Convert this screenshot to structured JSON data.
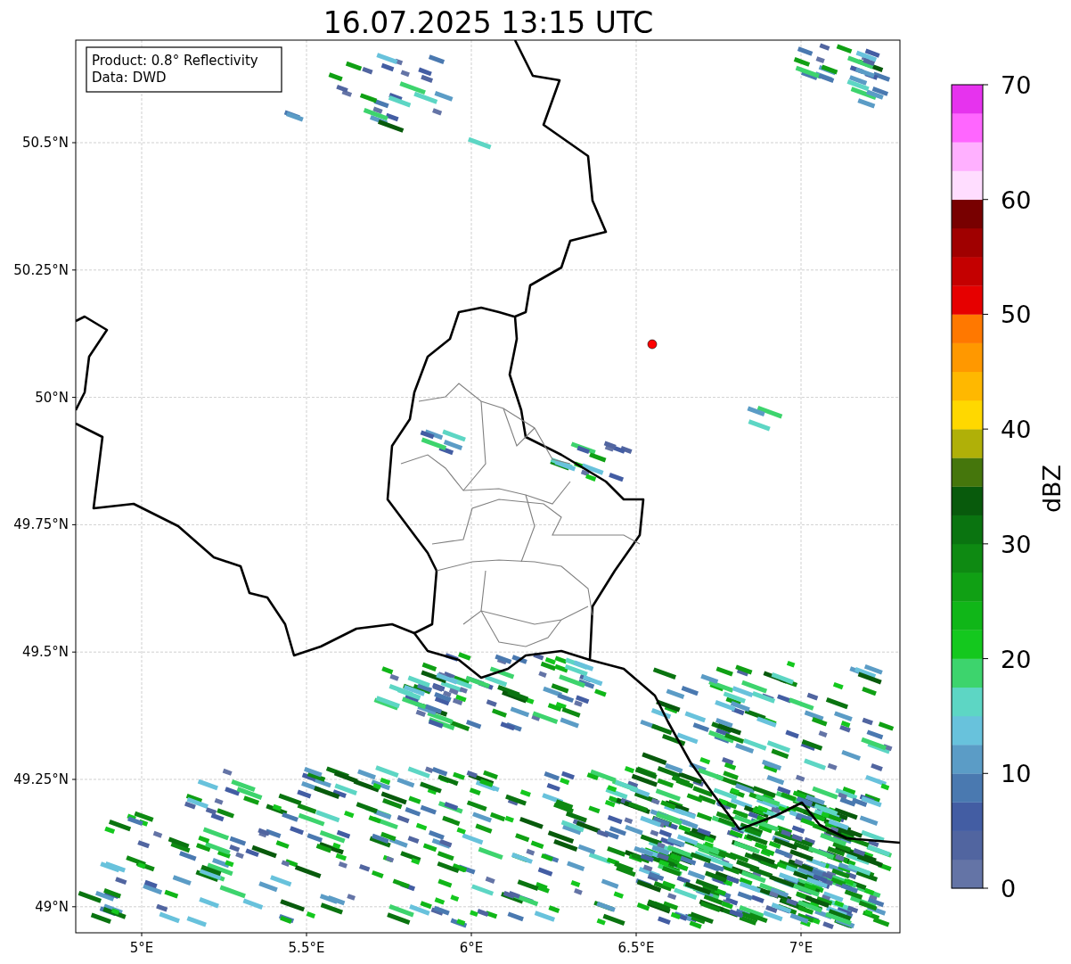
{
  "title": "16.07.2025 13:15 UTC",
  "legend": [
    "Product: 0.8° Reflectivity",
    "Data: DWD"
  ],
  "lat_ticks": [
    "50.5°N",
    "50.25°N",
    "50°N",
    "49.75°N",
    "49.5°N",
    "49.25°N",
    "49°N"
  ],
  "lon_ticks": [
    "5°E",
    "5.5°E",
    "6°E",
    "6.5°E",
    "7°E"
  ],
  "colorbar": {
    "label": "dBZ",
    "ticks": [
      "70",
      "60",
      "50",
      "40",
      "30",
      "20",
      "10",
      "0"
    ],
    "bands": [
      {
        "color": "#e633ee"
      },
      {
        "color": "#ff66ff"
      },
      {
        "color": "#ffb0ff"
      },
      {
        "color": "#ffddff"
      },
      {
        "color": "#780000"
      },
      {
        "color": "#a00000"
      },
      {
        "color": "#c40000"
      },
      {
        "color": "#e60000"
      },
      {
        "color": "#ff7800"
      },
      {
        "color": "#ff9800"
      },
      {
        "color": "#ffb800"
      },
      {
        "color": "#ffd800"
      },
      {
        "color": "#b0b008"
      },
      {
        "color": "#45760c"
      },
      {
        "color": "#085a0c"
      },
      {
        "color": "#0a7410"
      },
      {
        "color": "#0e8a12"
      },
      {
        "color": "#10a014"
      },
      {
        "color": "#10b618"
      },
      {
        "color": "#14c81e"
      },
      {
        "color": "#3dd46d"
      },
      {
        "color": "#5dd6c4"
      },
      {
        "color": "#68c2dc"
      },
      {
        "color": "#5b9cc6"
      },
      {
        "color": "#4a79b0"
      },
      {
        "color": "#435da3"
      },
      {
        "color": "#5165a0"
      },
      {
        "color": "#6474a6"
      }
    ]
  }
}
